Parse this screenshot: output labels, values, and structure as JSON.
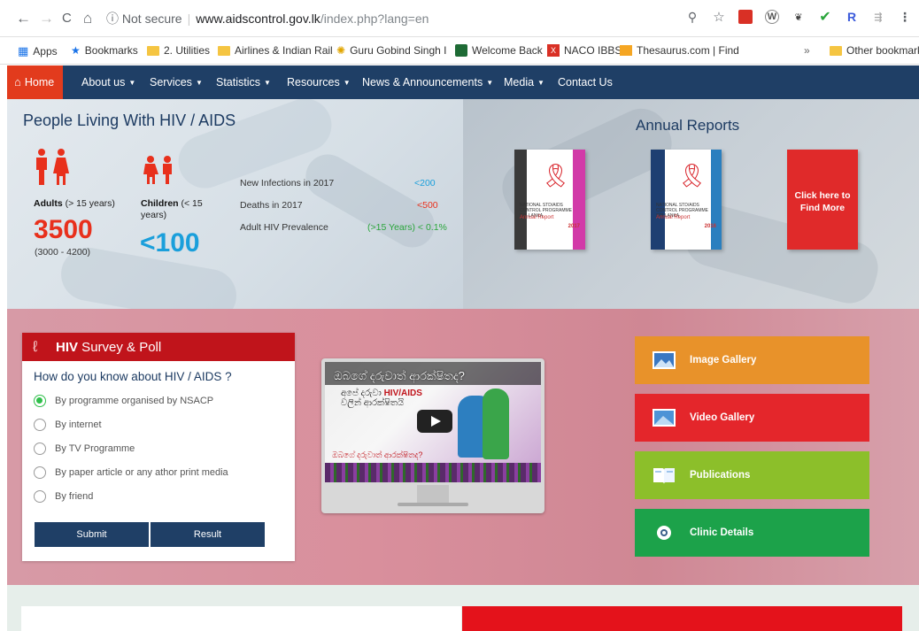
{
  "browser": {
    "nav": {
      "back": "←",
      "forward": "→",
      "reload": "C",
      "home": "⌂"
    },
    "security": "ⓘ Not secure",
    "url_host": "www.aidscontrol.gov.lk",
    "url_path": "/index.php?lang=en",
    "bookmarks": [
      "Apps",
      "Bookmarks",
      "2. Utilities",
      "Airlines & Indian Rail",
      "Guru Gobind Singh I",
      "Welcome Back",
      "NACO IBBS",
      "Thesaurus.com | Find"
    ],
    "overflow": "»",
    "other_bookmarks": "Other bookmarks"
  },
  "site_nav": {
    "home": "Home",
    "items": [
      "About us",
      "Services",
      "Statistics",
      "Resources",
      "News & Announcements",
      "Media",
      "Contact Us"
    ]
  },
  "plhiv": {
    "title": "People Living With HIV / AIDS",
    "adults_label": "Adults",
    "adults_qual": "(> 15 years)",
    "adults_value": "3500",
    "adults_range": "(3000 - 4200)",
    "children_label": "Children",
    "children_qual": "(< 15 years)",
    "children_value": "<100",
    "stats": [
      {
        "label": "New Infections in 2017",
        "value": "<200",
        "color": "#1a9fdb"
      },
      {
        "label": "Deaths in 2017",
        "value": "<500",
        "color": "#e8301c"
      },
      {
        "label": "Adult HIV Prevalence",
        "value": "(>15 Years) < 0.1%",
        "color": "#2aa53b"
      }
    ]
  },
  "annual_reports": {
    "title": "Annual Reports",
    "report_2017_text": "NATIONAL STD/AIDS CONTROL PROGRAMME SRI LANKA",
    "report_2017_name": "Annual Report",
    "report_2017_year": "2017",
    "report_2016_text": "NATIONAL STD/AIDS CONTROL PROGRAMME SRI LANKA",
    "report_2016_name": "Annual Report",
    "report_2016_year": "2016",
    "find_more": "Click here to Find More"
  },
  "survey": {
    "title_bold": "HIV",
    "title_rest": " Survey & Poll",
    "question": "How do you know about HIV / AIDS ?",
    "options": [
      "By programme organised by NSACP",
      "By internet",
      "By TV Programme",
      "By paper article or any athor print media",
      "By friend"
    ],
    "selected_index": 0,
    "submit": "Submit",
    "result": "Result"
  },
  "video": {
    "title": "ඔබගේ දරුවාත් ආරක්ෂිතද?",
    "sub_prefix": "අපේ දරුවා ",
    "sub_highlight": "HIV/AIDS",
    "sub_suffix": "වලින් ආරක්ෂිතයි",
    "bottom": "ඔබගේ දරුවාත් ආරක්ෂිතද?"
  },
  "tiles": [
    {
      "label": "Image Gallery",
      "color": "#e8922a",
      "icon": "image-icon"
    },
    {
      "label": "Video Gallery",
      "color": "#e4262b",
      "icon": "video-icon"
    },
    {
      "label": "Publications",
      "color": "#8cbf2a",
      "icon": "book-icon"
    },
    {
      "label": "Clinic Details",
      "color": "#1ca24a",
      "icon": "gear-icon"
    }
  ]
}
